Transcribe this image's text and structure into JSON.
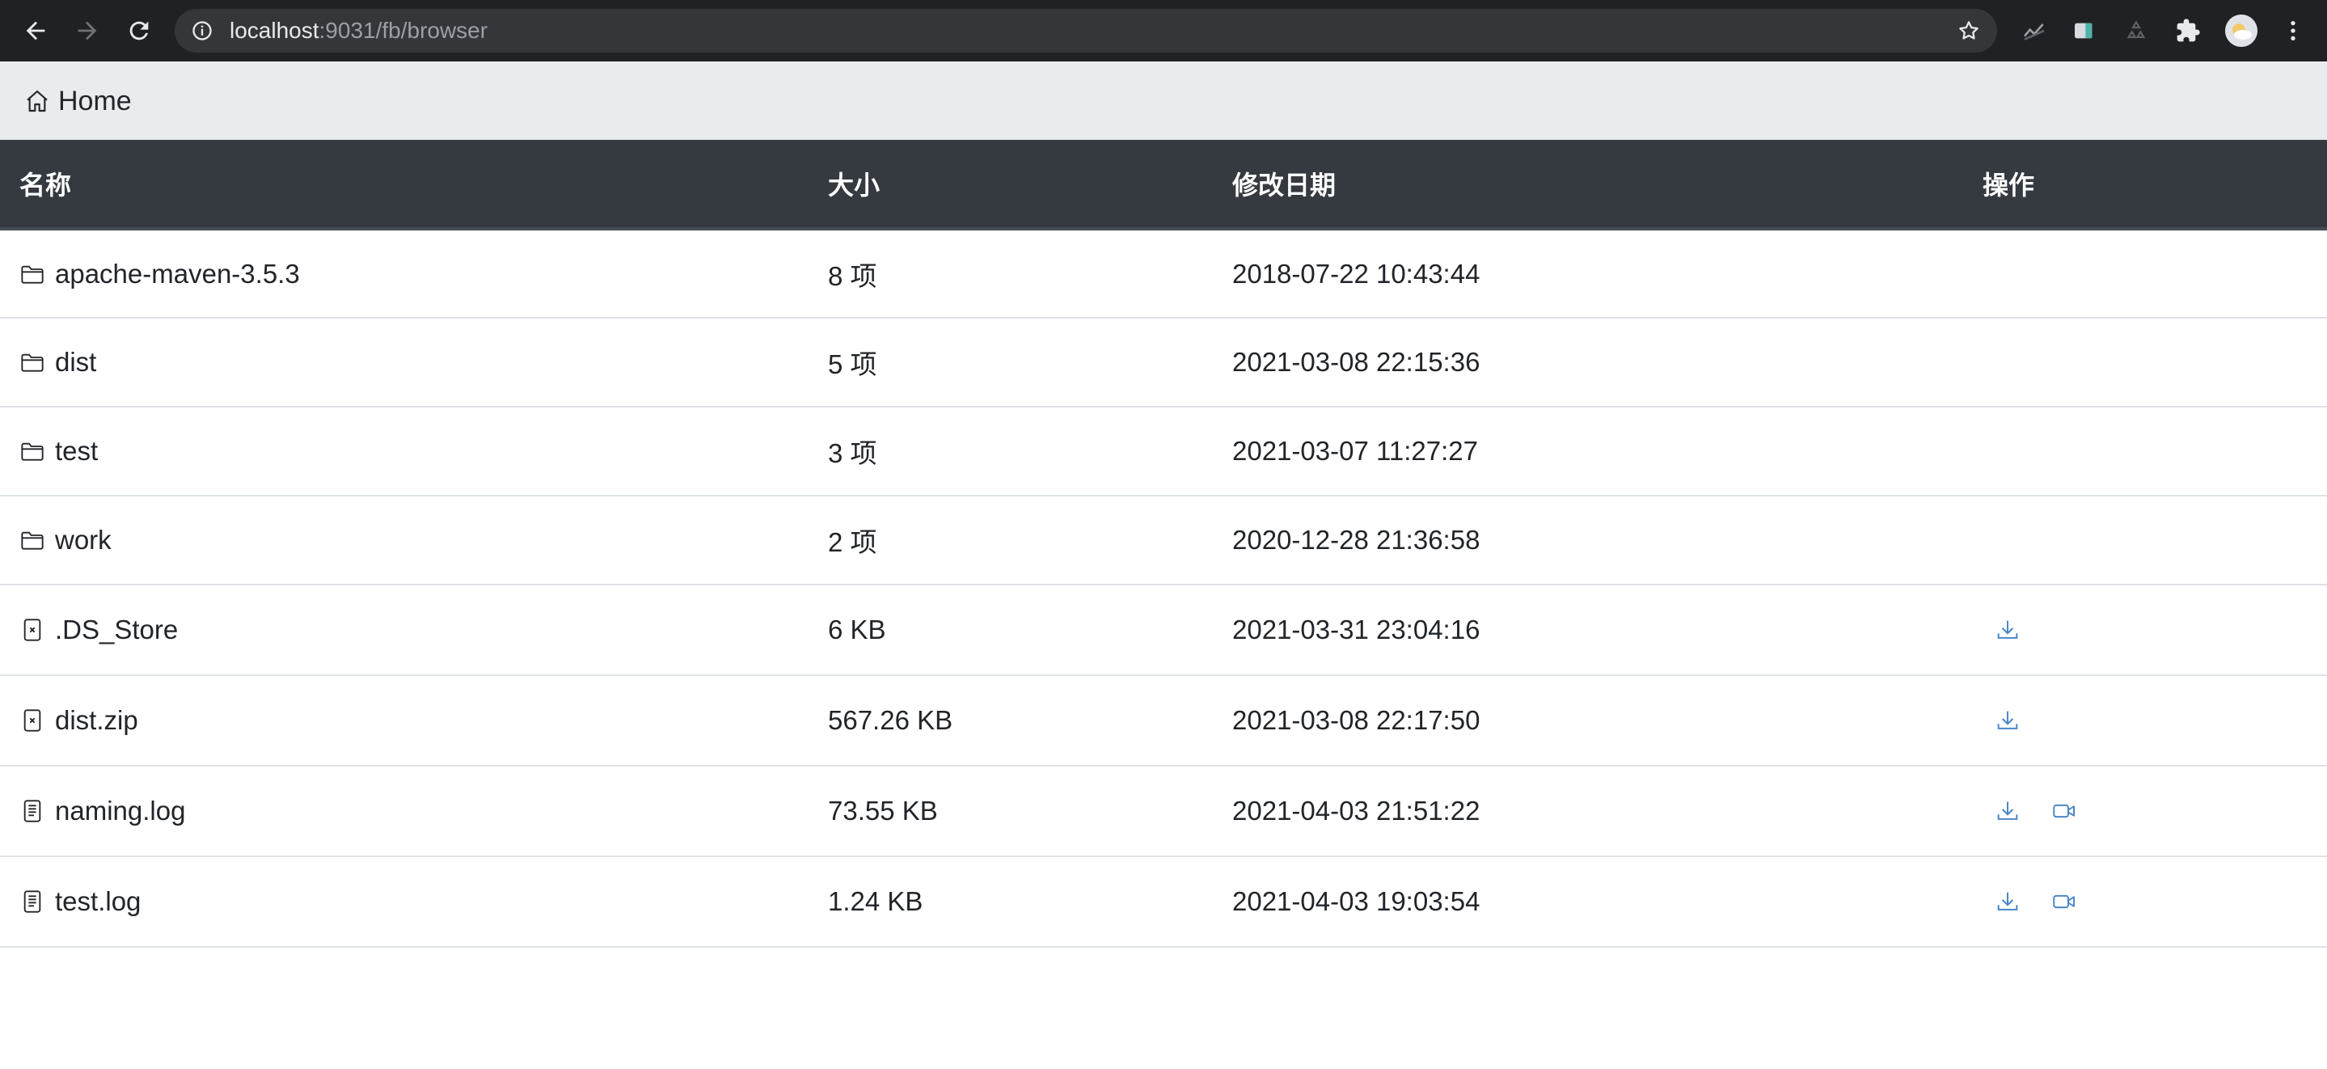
{
  "browser": {
    "url_host": "localhost",
    "url_path": ":9031/fb/browser"
  },
  "breadcrumb": {
    "home_label": "Home"
  },
  "table": {
    "headers": {
      "name": "名称",
      "size": "大小",
      "modified": "修改日期",
      "actions": "操作"
    },
    "rows": [
      {
        "name": "apache-maven-3.5.3",
        "size": "8 项",
        "modified": "2018-07-22 10:43:44",
        "icon": "folder-icon"
      },
      {
        "name": "dist",
        "size": "5 项",
        "modified": "2021-03-08 22:15:36",
        "icon": "folder-icon"
      },
      {
        "name": "test",
        "size": "3 项",
        "modified": "2021-03-07 11:27:27",
        "icon": "folder-icon"
      },
      {
        "name": "work",
        "size": "2 项",
        "modified": "2020-12-28 21:36:58",
        "icon": "folder-icon"
      },
      {
        "name": ".DS_Store",
        "size": "6 KB",
        "modified": "2021-03-31 23:04:16",
        "icon": "binary-file-icon"
      },
      {
        "name": "dist.zip",
        "size": "567.26 KB",
        "modified": "2021-03-08 22:17:50",
        "icon": "binary-file-icon"
      },
      {
        "name": "naming.log",
        "size": "73.55 KB",
        "modified": "2021-04-03 21:51:22",
        "icon": "text-file-icon"
      },
      {
        "name": "test.log",
        "size": "1.24 KB",
        "modified": "2021-04-03 19:03:54",
        "icon": "text-file-icon"
      }
    ]
  },
  "colors": {
    "header_bg": "#343a40",
    "breadcrumb_bg": "#e9ecef",
    "action_icon": "#4a86c8"
  }
}
